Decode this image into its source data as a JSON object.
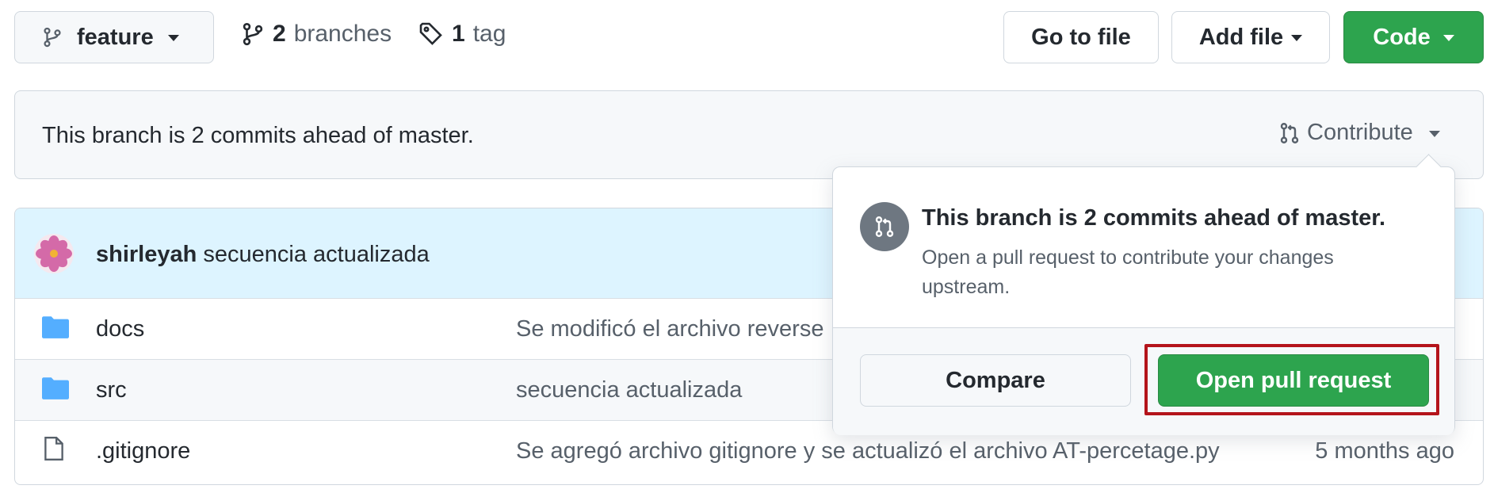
{
  "header": {
    "branch_label": "feature",
    "branches_count": "2",
    "branches_text": "branches",
    "tags_count": "1",
    "tags_text": "tag",
    "go_to_file": "Go to file",
    "add_file": "Add file",
    "code": "Code"
  },
  "branch_bar": {
    "status_text": "This branch is 2 commits ahead of master.",
    "contribute_label": "Contribute"
  },
  "latest_commit": {
    "author": "shirleyah",
    "message": "secuencia actualizada"
  },
  "files": [
    {
      "name": "docs",
      "type": "folder",
      "message": "Se modificó el archivo reverse",
      "age": ""
    },
    {
      "name": "src",
      "type": "folder",
      "message": "secuencia actualizada",
      "age": ""
    },
    {
      "name": ".gitignore",
      "type": "file",
      "message": "Se agregó archivo gitignore y se actualizó el archivo AT-percetage.py",
      "age": "5 months ago"
    }
  ],
  "popover": {
    "title": "This branch is 2 commits ahead of master.",
    "description_line1": "Open a pull request to contribute your changes",
    "description_line2": "upstream.",
    "compare_button": "Compare",
    "open_pr_button": "Open pull request"
  },
  "colors": {
    "green": "#2da44e",
    "highlight_border": "#b4141b",
    "folder_blue": "#54aeff"
  }
}
